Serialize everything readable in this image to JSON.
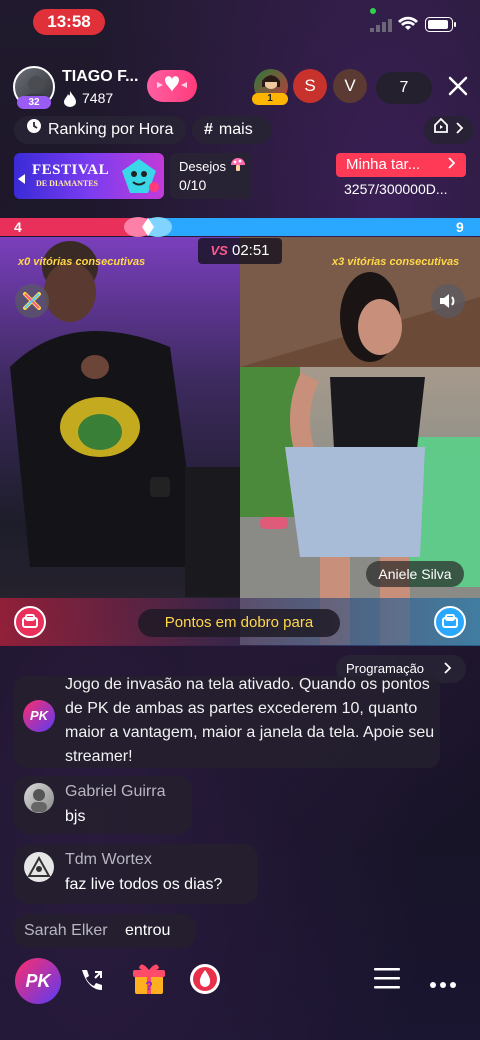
{
  "status": {
    "time": "13:58"
  },
  "host": {
    "name": "TIAGO F...",
    "likes": "7487",
    "level": "32"
  },
  "viewers": {
    "v1_badge": "1",
    "v2_initial": "S",
    "v3_initial": "V",
    "count": "7"
  },
  "chips": {
    "ranking": "Ranking por Hora",
    "mais": "mais"
  },
  "festival": {
    "title": "FESTIVAL",
    "subtitle": "DE DIAMANTES"
  },
  "desejos": {
    "label": "Desejos",
    "value": "0/10"
  },
  "task": {
    "title": "Minha tar...",
    "progress": "3257/300000D..."
  },
  "pk": {
    "left_score": "4",
    "right_score": "9",
    "vs": "VS",
    "timer": "02:51"
  },
  "streaks": {
    "left": "x0 vitórias consecutivas",
    "right": "x3 vitórias consecutivas"
  },
  "guest": {
    "name": "Aniele Silva"
  },
  "double_points": "Pontos em dobro para",
  "programacao": "Programação",
  "system_message": {
    "badge": "PK",
    "text": "Jogo de invasão na tela ativado. Quando os pontos de PK de ambas as partes excederem 10, quanto maior a vantagem, maior a janela da tela. Apoie seu streamer!"
  },
  "chat": [
    {
      "name": "Gabriel Guirra",
      "text": "bjs"
    },
    {
      "name": "Tdm Wortex",
      "text": "faz live todos os dias?"
    }
  ],
  "join": {
    "name": "Sarah Elker",
    "action": "entrou"
  },
  "bottom": {
    "pk_label": "PK"
  },
  "colors": {
    "accent_red": "#ff3a57",
    "pk_red": "#e8305a",
    "pk_blue": "#2aa8ff",
    "streak_yellow": "#ffd84a"
  }
}
